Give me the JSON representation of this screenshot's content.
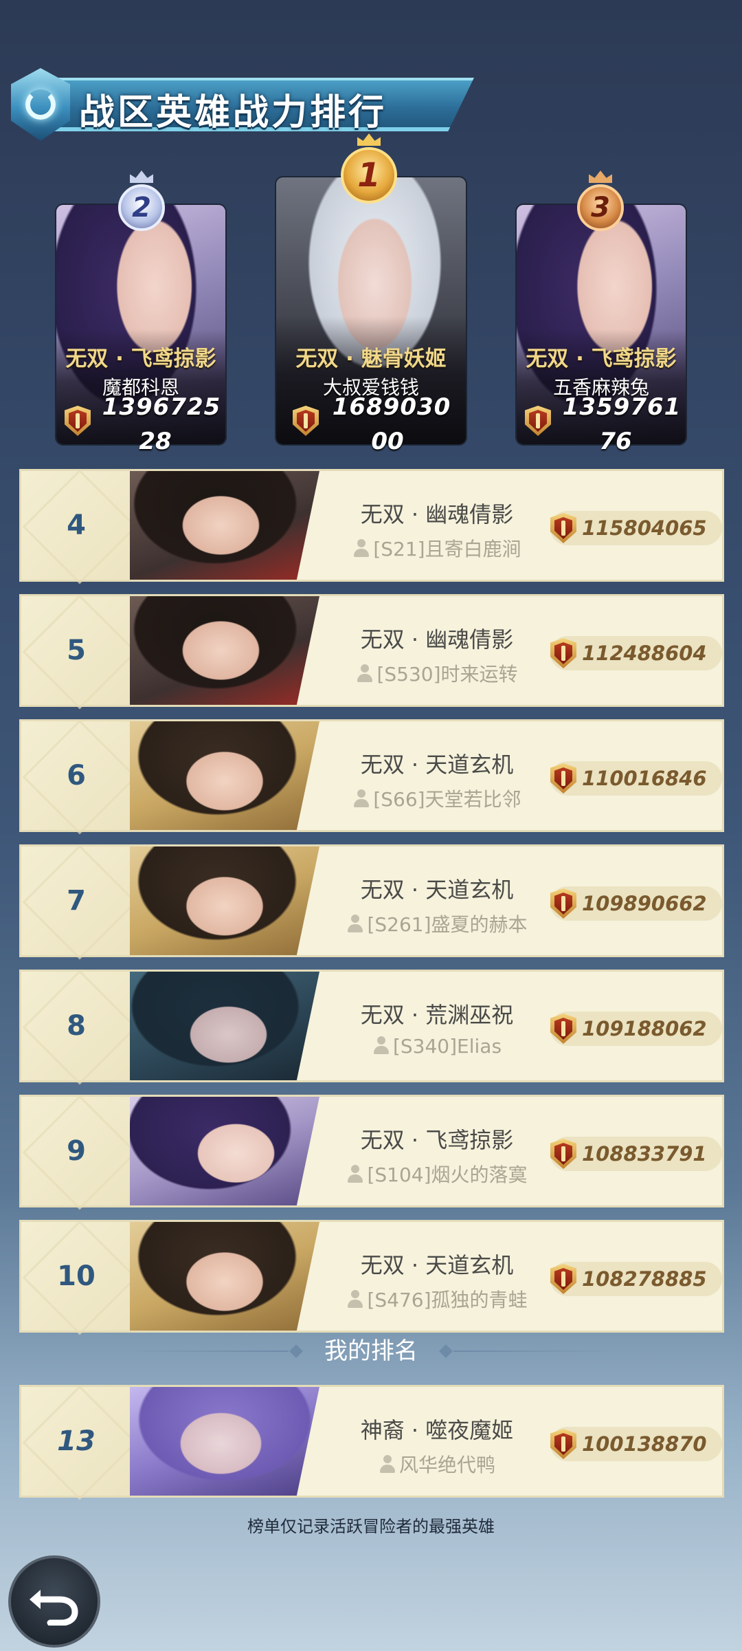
{
  "title": "战区英雄战力排行",
  "podium": [
    {
      "rank": "2",
      "hero": "无双 · 飞鸢掠影",
      "player": "魔都科恩",
      "power": "1396725",
      "power_tail": "28"
    },
    {
      "rank": "1",
      "hero": "无双 · 魅骨妖姬",
      "player": "大叔爱钱钱",
      "power": "1689030",
      "power_tail": "00"
    },
    {
      "rank": "3",
      "hero": "无双 · 飞鸢掠影",
      "player": "五香麻辣兔",
      "power": "1359761",
      "power_tail": "76"
    }
  ],
  "rows": [
    {
      "rank": "4",
      "hero": "无双 · 幽魂倩影",
      "player": "[S21]且寄白鹿涧",
      "power": "115804065"
    },
    {
      "rank": "5",
      "hero": "无双 · 幽魂倩影",
      "player": "[S530]时来运转",
      "power": "112488604"
    },
    {
      "rank": "6",
      "hero": "无双 · 天道玄机",
      "player": "[S66]天堂若比邻",
      "power": "110016846"
    },
    {
      "rank": "7",
      "hero": "无双 · 天道玄机",
      "player": "[S261]盛夏的赫本",
      "power": "109890662"
    },
    {
      "rank": "8",
      "hero": "无双 · 荒渊巫祝",
      "player": "[S340]Elias",
      "power": "109188062"
    },
    {
      "rank": "9",
      "hero": "无双 · 飞鸢掠影",
      "player": "[S104]烟火的落寞",
      "power": "108833791"
    },
    {
      "rank": "10",
      "hero": "无双 · 天道玄机",
      "player": "[S476]孤独的青蛙",
      "power": "108278885"
    }
  ],
  "my_rank_label": "我的排名",
  "my_rank": {
    "rank": "13",
    "hero": "神裔 · 噬夜魔姬",
    "player": "风华绝代鸭",
    "power": "100138870"
  },
  "footer_note": "榜单仅记录活跃冒险者的最强英雄",
  "icons": {
    "power": "power-shield-icon",
    "player": "person-icon",
    "back": "back-arrow-icon",
    "emblem": "emblem-icon"
  },
  "colors": {
    "row_bg": "#f6f2dc",
    "rank_number": "#30587f",
    "power_text": "#7a5a2e",
    "hero_gold": "#f1d889"
  }
}
